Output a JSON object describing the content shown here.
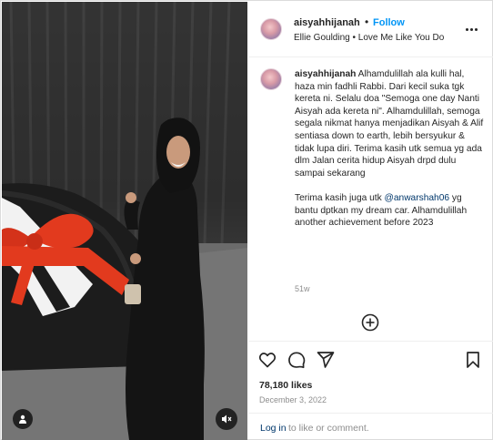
{
  "post": {
    "username": "aisyahhijanah",
    "separator": "•",
    "follow_label": "Follow",
    "audio": "Ellie Goulding • Love Me Like You Do"
  },
  "caption": {
    "username": "aisyahhijanah",
    "text_part1": "Alhamdulillah ala kulli hal, haza min fadhli Rabbi. Dari kecil suka tgk kereta ni. Selalu doa \"Semoga one day Nanti Aisyah ada kereta ni\". Alhamdulillah, semoga segala nikmat hanya menjadikan Aisyah & Alif sentiasa down to earth, lebih bersyukur & tidak lupa diri. Terima kasih utk semua yg ada dlm Jalan cerita hidup Aisyah drpd dulu sampai sekarang",
    "text_part2_prefix": "Terima kasih juga utk ",
    "mention": "@anwarshah06",
    "text_part2_suffix": " yg bantu dptkan my dream car. Alhamdulillah another achievement before 2023",
    "time_ago": "51w"
  },
  "stats": {
    "likes": "78,180 likes",
    "date": "December 3, 2022"
  },
  "footer": {
    "login_link": "Log in",
    "login_rest": "to like or comment."
  },
  "icons": {
    "more": "more-options-icon",
    "load_more": "plus-circle-icon",
    "like": "heart-icon",
    "comment": "comment-bubble-icon",
    "share": "send-paper-plane-icon",
    "save": "bookmark-icon",
    "user_tag": "user-tag-icon",
    "mute": "speaker-muted-icon"
  },
  "colors": {
    "accent": "#0095f6",
    "link": "#00376b",
    "text": "#262626",
    "muted": "#8e8e8e",
    "bow": "#e23a1e"
  }
}
